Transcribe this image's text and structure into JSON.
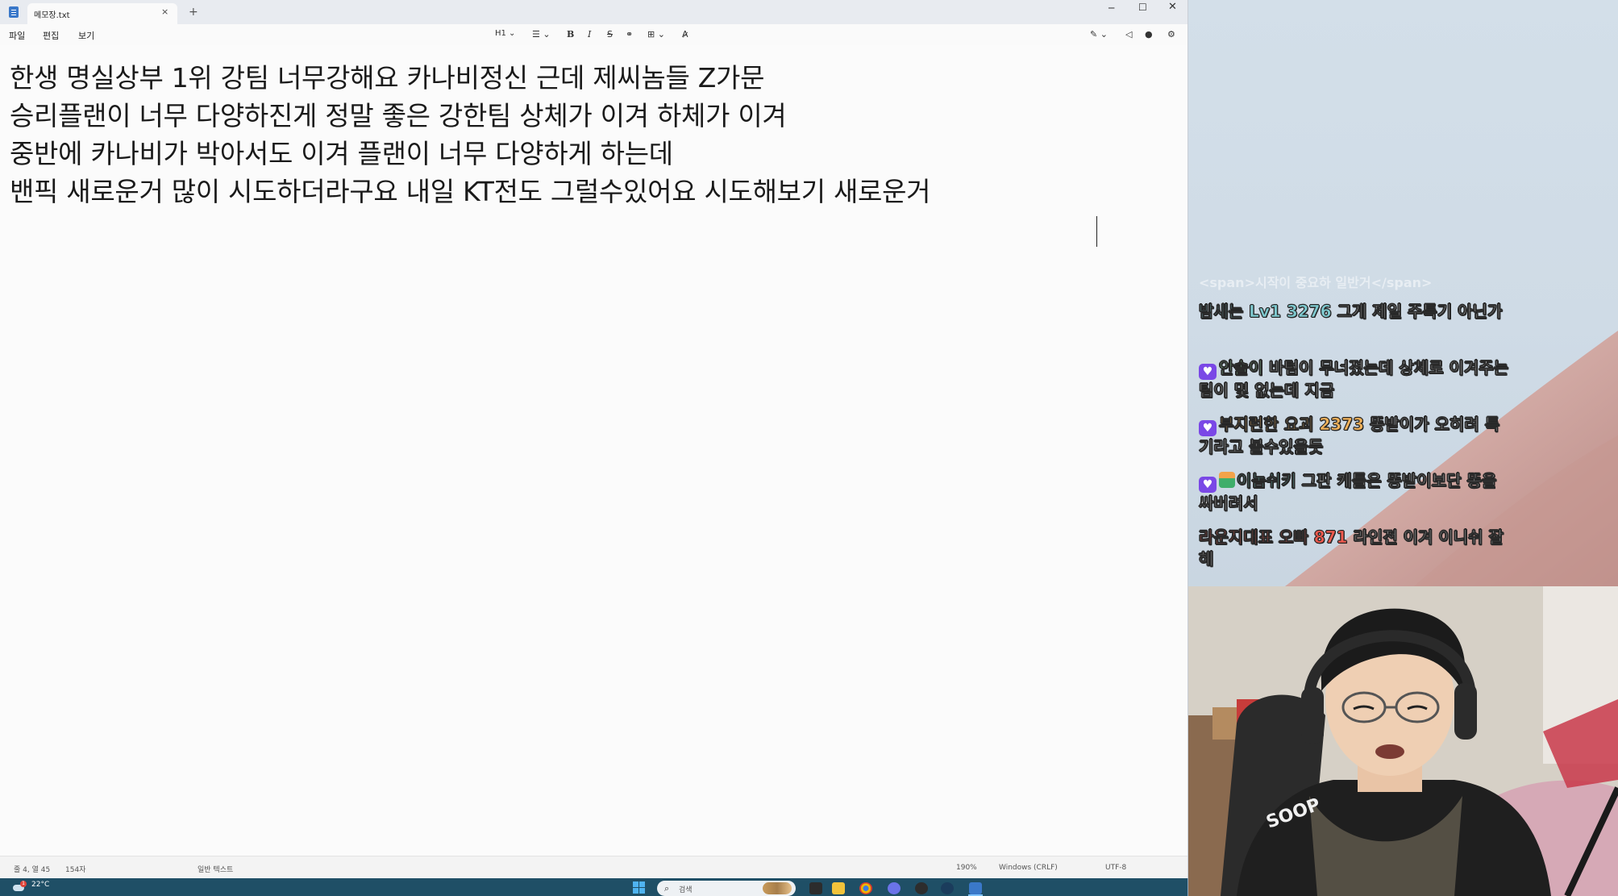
{
  "window": {
    "tab_title": "메모장.txt",
    "tab_close": "×",
    "new_tab": "+",
    "minimize": "─",
    "maximize": "☐",
    "close": "✕"
  },
  "menu": {
    "file": "파일",
    "edit": "편집",
    "view": "보기"
  },
  "toolbar": {
    "heading": "H1 ⌄",
    "list": "☰ ⌄",
    "bold": "B",
    "italic": "I",
    "strikethrough": "S",
    "link": "⚭",
    "table": "⊞ ⌄",
    "clear_format": "A̷",
    "ai": "✎ ⌄",
    "share": "◁",
    "account": "●",
    "settings": "⚙"
  },
  "document": {
    "lines": [
      "한생 명실상부 1위 강팀 너무강해요 카나비정신 근데 제씨놈들 Z가문",
      "승리플랜이 너무 다양하진게 정말 좋은 강한팀 상체가 이겨 하체가 이겨",
      "중반에 카나비가 박아서도 이겨 플랜이 너무 다양하게 하는데",
      "밴픽 새로운거 많이 시도하더라구요 내일 KT전도 그럴수있어요 시도해보기 새로운거"
    ]
  },
  "status": {
    "position": "줄 4, 열 45",
    "chars": "154자",
    "format": "일반 텍스트",
    "zoom": "190%",
    "line_ending": "Windows (CRLF)",
    "encoding": "UTF-8"
  },
  "taskbar": {
    "weather_temp": "22°C",
    "weather_badge": "1",
    "search_placeholder": "검색",
    "search_icon": "⌕"
  },
  "chat": {
    "faded": "<span>시작이 중요하 일반거</span>",
    "messages": [
      {
        "name": "밤새는 Lv1 3276",
        "text": "그게 제일 주특기 아닌가",
        "badge": "none"
      },
      {
        "name": "안솔이",
        "text": "바텀이 무너졌는데 상체로 이겨주는 팀이 몇 없는데 지금",
        "badge": "heart"
      },
      {
        "name": "부지런한 요괴 2373",
        "text": "똥받이가 오히려 특기라고 볼수있을듯",
        "badge": "heart"
      },
      {
        "name": "이놈쉬키",
        "text": "그판 케틀은 똥받이보단 똥을 싸버려서",
        "badge": "heart+mini"
      },
      {
        "name": "라운지대표 오빠 871",
        "text": "라인전 이겨 이니쉬 잘해",
        "badge": "none"
      }
    ]
  },
  "colors": {
    "chat_name_1": "#7ec9cf",
    "chat_name_2": "#a7f0b8",
    "chat_name_3": "#f2b25a",
    "chat_name_4": "#6fd3c7",
    "chat_name_5": "#f05a4e",
    "heart_badge": "#7a48e6",
    "taskbar": "#1f4f66"
  }
}
